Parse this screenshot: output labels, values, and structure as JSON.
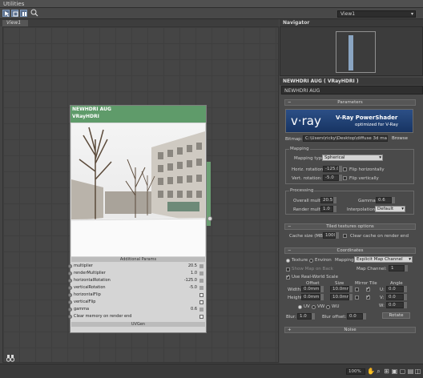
{
  "menu": {
    "utilities": "Utilities"
  },
  "toolbar": {
    "view_select": "View1"
  },
  "view_tab": {
    "label": "View1"
  },
  "node": {
    "title": "NEWHDRI AUG",
    "subtitle": "VRayHDRI",
    "section_additional": "Additional Params",
    "section_uvgen": "UVGen",
    "params": [
      {
        "name": "multiplier",
        "value": "20.5",
        "control": "spinner"
      },
      {
        "name": "renderMultiplier",
        "value": "1.0",
        "control": "spinner"
      },
      {
        "name": "horizontalRotation",
        "value": "-125.0",
        "control": "spinner"
      },
      {
        "name": "verticalRotation",
        "value": "-5.0",
        "control": "spinner"
      },
      {
        "name": "horizontalFlip",
        "value": "",
        "control": "checkbox"
      },
      {
        "name": "verticalFlip",
        "value": "",
        "control": "checkbox"
      },
      {
        "name": "gamma",
        "value": "0.6",
        "control": "spinner"
      },
      {
        "name": "Clear memory on render end",
        "value": "",
        "control": "checkbox"
      }
    ]
  },
  "navigator": {
    "title": "Navigator"
  },
  "properties": {
    "header": "NEWHDRI AUG  ( VRayHDRI )",
    "name_field": "NEWHDRI AUG",
    "parameters_rollout": "Parameters",
    "vray_logo": "v·ray",
    "vray_title": "V-Ray PowerShader",
    "vray_sub": "optimized for V-Ray",
    "bitmap_label": "Bitmap:",
    "bitmap_path": "C:\\Users\\ricky\\Desktop\\diffuse 3d materia",
    "browse": "Browse",
    "mapping_group": "Mapping",
    "mapping_type_label": "Mapping type:",
    "mapping_type_value": "Spherical",
    "horiz_rotation_label": "Horiz. rotation:",
    "horiz_rotation_value": "-125.0",
    "flip_h": "Flip horizontally",
    "vert_rotation_label": "Vert. rotation:",
    "vert_rotation_value": "-5.0",
    "flip_v": "Flip vertically",
    "processing_group": "Processing",
    "overall_mult_label": "Overall mult:",
    "overall_mult_value": "20.5",
    "gamma_label": "Gamma:",
    "gamma_value": "0.6",
    "render_mult_label": "Render mult:",
    "render_mult_value": "1.0",
    "interpolation_label": "Interpolation:",
    "interpolation_value": "Default",
    "tiled_rollout": "Tiled textures options",
    "cache_size_label": "Cache size (MB):",
    "cache_size_value": "1000",
    "clear_cache": "Clear cache on render end",
    "coordinates_rollout": "Coordinates",
    "texture_radio": "Texture",
    "environ_radio": "Environ",
    "mapping_label": "Mapping:",
    "mapping_value": "Explicit Map Channel",
    "show_map_on_back": "Show Map on Back",
    "map_channel_label": "Map Channel:",
    "map_channel_value": "1",
    "use_real_world": "Use Real-World Scale",
    "col_offset": "Offset",
    "col_size": "Size",
    "col_mirror_tile": "Mirror Tile",
    "col_angle": "Angle",
    "width_label": "Width:",
    "width_offset": "0.0mm",
    "width_size": "10.0mm",
    "u_label": "U:",
    "u_angle": "0.0",
    "height_label": "Height:",
    "height_offset": "0.0mm",
    "height_size": "10.0mm",
    "v_label": "V:",
    "v_angle": "0.0",
    "w_label": "W:",
    "w_angle": "0.0",
    "uv": "UV",
    "vw": "VW",
    "wu": "WU",
    "blur_label": "Blur:",
    "blur_value": "1.0",
    "blur_offset_label": "Blur offset:",
    "blur_offset_value": "0.0",
    "rotate": "Rotate",
    "noise_rollout": "Noise"
  },
  "status": {
    "zoom": "100%"
  },
  "colors": {
    "node_header": "#5f9b6a",
    "vray_banner": "#1f3f74",
    "panel_bg": "#4a4a4a"
  }
}
